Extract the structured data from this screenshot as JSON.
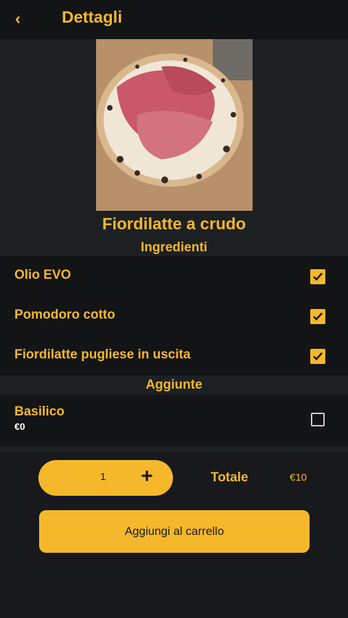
{
  "header": {
    "title": "Dettagli",
    "back_icon": "chevron-left-icon"
  },
  "product": {
    "name": "Fiordilatte a crudo",
    "image_alt": "pizza photo"
  },
  "ingredients_section": {
    "title": "Ingredienti",
    "items": [
      {
        "label": "Olio EVO",
        "checked": true
      },
      {
        "label": "Pomodoro cotto",
        "checked": true
      },
      {
        "label": "Fiordilatte pugliese in uscita",
        "checked": true
      }
    ]
  },
  "addons_section": {
    "title": "Aggiunte",
    "items": [
      {
        "label": "Basilico",
        "price": "€0",
        "checked": false
      }
    ]
  },
  "order": {
    "quantity": "1",
    "total_label": "Totale",
    "total_value": "€10",
    "add_to_cart_label": "Aggiungi al carrello"
  },
  "colors": {
    "accent": "#f5b82a",
    "background": "#17191c"
  }
}
